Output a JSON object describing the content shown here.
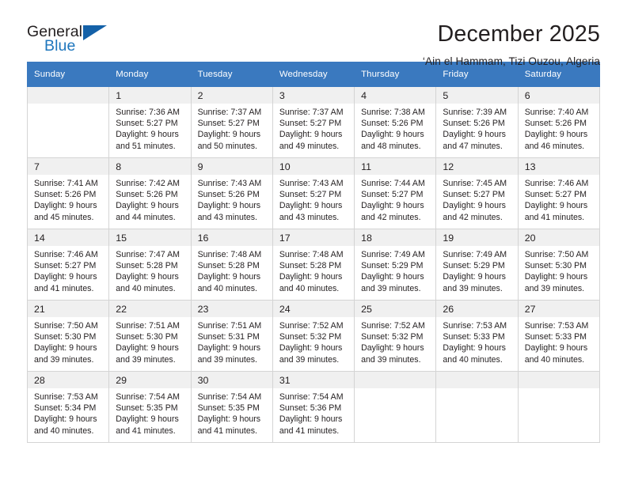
{
  "brand": {
    "name_part1": "General",
    "name_part2": "Blue",
    "triangle_color": "#1461a8",
    "blue_text_color": "#1e76bd"
  },
  "header": {
    "title": "December 2025",
    "subtitle": "‘Ain el Hammam, Tizi Ouzou, Algeria"
  },
  "theme": {
    "header_background": "#3a79bf",
    "header_text": "#ffffff",
    "daynum_background": "#f0f0f0",
    "cell_border": "#d4d4d4",
    "text": "#231f20"
  },
  "weekday_headers": [
    "Sunday",
    "Monday",
    "Tuesday",
    "Wednesday",
    "Thursday",
    "Friday",
    "Saturday"
  ],
  "labels": {
    "sunrise_prefix": "Sunrise:",
    "sunset_prefix": "Sunset:",
    "daylight_prefix": "Daylight:"
  },
  "weeks": [
    [
      {
        "day": "",
        "empty": true
      },
      {
        "day": "1",
        "sunrise": "Sunrise: 7:36 AM",
        "sunset": "Sunset: 5:27 PM",
        "daylight_line1": "Daylight: 9 hours",
        "daylight_line2": "and 51 minutes."
      },
      {
        "day": "2",
        "sunrise": "Sunrise: 7:37 AM",
        "sunset": "Sunset: 5:27 PM",
        "daylight_line1": "Daylight: 9 hours",
        "daylight_line2": "and 50 minutes."
      },
      {
        "day": "3",
        "sunrise": "Sunrise: 7:37 AM",
        "sunset": "Sunset: 5:27 PM",
        "daylight_line1": "Daylight: 9 hours",
        "daylight_line2": "and 49 minutes."
      },
      {
        "day": "4",
        "sunrise": "Sunrise: 7:38 AM",
        "sunset": "Sunset: 5:26 PM",
        "daylight_line1": "Daylight: 9 hours",
        "daylight_line2": "and 48 minutes."
      },
      {
        "day": "5",
        "sunrise": "Sunrise: 7:39 AM",
        "sunset": "Sunset: 5:26 PM",
        "daylight_line1": "Daylight: 9 hours",
        "daylight_line2": "and 47 minutes."
      },
      {
        "day": "6",
        "sunrise": "Sunrise: 7:40 AM",
        "sunset": "Sunset: 5:26 PM",
        "daylight_line1": "Daylight: 9 hours",
        "daylight_line2": "and 46 minutes."
      }
    ],
    [
      {
        "day": "7",
        "sunrise": "Sunrise: 7:41 AM",
        "sunset": "Sunset: 5:26 PM",
        "daylight_line1": "Daylight: 9 hours",
        "daylight_line2": "and 45 minutes."
      },
      {
        "day": "8",
        "sunrise": "Sunrise: 7:42 AM",
        "sunset": "Sunset: 5:26 PM",
        "daylight_line1": "Daylight: 9 hours",
        "daylight_line2": "and 44 minutes."
      },
      {
        "day": "9",
        "sunrise": "Sunrise: 7:43 AM",
        "sunset": "Sunset: 5:26 PM",
        "daylight_line1": "Daylight: 9 hours",
        "daylight_line2": "and 43 minutes."
      },
      {
        "day": "10",
        "sunrise": "Sunrise: 7:43 AM",
        "sunset": "Sunset: 5:27 PM",
        "daylight_line1": "Daylight: 9 hours",
        "daylight_line2": "and 43 minutes."
      },
      {
        "day": "11",
        "sunrise": "Sunrise: 7:44 AM",
        "sunset": "Sunset: 5:27 PM",
        "daylight_line1": "Daylight: 9 hours",
        "daylight_line2": "and 42 minutes."
      },
      {
        "day": "12",
        "sunrise": "Sunrise: 7:45 AM",
        "sunset": "Sunset: 5:27 PM",
        "daylight_line1": "Daylight: 9 hours",
        "daylight_line2": "and 42 minutes."
      },
      {
        "day": "13",
        "sunrise": "Sunrise: 7:46 AM",
        "sunset": "Sunset: 5:27 PM",
        "daylight_line1": "Daylight: 9 hours",
        "daylight_line2": "and 41 minutes."
      }
    ],
    [
      {
        "day": "14",
        "sunrise": "Sunrise: 7:46 AM",
        "sunset": "Sunset: 5:27 PM",
        "daylight_line1": "Daylight: 9 hours",
        "daylight_line2": "and 41 minutes."
      },
      {
        "day": "15",
        "sunrise": "Sunrise: 7:47 AM",
        "sunset": "Sunset: 5:28 PM",
        "daylight_line1": "Daylight: 9 hours",
        "daylight_line2": "and 40 minutes."
      },
      {
        "day": "16",
        "sunrise": "Sunrise: 7:48 AM",
        "sunset": "Sunset: 5:28 PM",
        "daylight_line1": "Daylight: 9 hours",
        "daylight_line2": "and 40 minutes."
      },
      {
        "day": "17",
        "sunrise": "Sunrise: 7:48 AM",
        "sunset": "Sunset: 5:28 PM",
        "daylight_line1": "Daylight: 9 hours",
        "daylight_line2": "and 40 minutes."
      },
      {
        "day": "18",
        "sunrise": "Sunrise: 7:49 AM",
        "sunset": "Sunset: 5:29 PM",
        "daylight_line1": "Daylight: 9 hours",
        "daylight_line2": "and 39 minutes."
      },
      {
        "day": "19",
        "sunrise": "Sunrise: 7:49 AM",
        "sunset": "Sunset: 5:29 PM",
        "daylight_line1": "Daylight: 9 hours",
        "daylight_line2": "and 39 minutes."
      },
      {
        "day": "20",
        "sunrise": "Sunrise: 7:50 AM",
        "sunset": "Sunset: 5:30 PM",
        "daylight_line1": "Daylight: 9 hours",
        "daylight_line2": "and 39 minutes."
      }
    ],
    [
      {
        "day": "21",
        "sunrise": "Sunrise: 7:50 AM",
        "sunset": "Sunset: 5:30 PM",
        "daylight_line1": "Daylight: 9 hours",
        "daylight_line2": "and 39 minutes."
      },
      {
        "day": "22",
        "sunrise": "Sunrise: 7:51 AM",
        "sunset": "Sunset: 5:30 PM",
        "daylight_line1": "Daylight: 9 hours",
        "daylight_line2": "and 39 minutes."
      },
      {
        "day": "23",
        "sunrise": "Sunrise: 7:51 AM",
        "sunset": "Sunset: 5:31 PM",
        "daylight_line1": "Daylight: 9 hours",
        "daylight_line2": "and 39 minutes."
      },
      {
        "day": "24",
        "sunrise": "Sunrise: 7:52 AM",
        "sunset": "Sunset: 5:32 PM",
        "daylight_line1": "Daylight: 9 hours",
        "daylight_line2": "and 39 minutes."
      },
      {
        "day": "25",
        "sunrise": "Sunrise: 7:52 AM",
        "sunset": "Sunset: 5:32 PM",
        "daylight_line1": "Daylight: 9 hours",
        "daylight_line2": "and 39 minutes."
      },
      {
        "day": "26",
        "sunrise": "Sunrise: 7:53 AM",
        "sunset": "Sunset: 5:33 PM",
        "daylight_line1": "Daylight: 9 hours",
        "daylight_line2": "and 40 minutes."
      },
      {
        "day": "27",
        "sunrise": "Sunrise: 7:53 AM",
        "sunset": "Sunset: 5:33 PM",
        "daylight_line1": "Daylight: 9 hours",
        "daylight_line2": "and 40 minutes."
      }
    ],
    [
      {
        "day": "28",
        "sunrise": "Sunrise: 7:53 AM",
        "sunset": "Sunset: 5:34 PM",
        "daylight_line1": "Daylight: 9 hours",
        "daylight_line2": "and 40 minutes."
      },
      {
        "day": "29",
        "sunrise": "Sunrise: 7:54 AM",
        "sunset": "Sunset: 5:35 PM",
        "daylight_line1": "Daylight: 9 hours",
        "daylight_line2": "and 41 minutes."
      },
      {
        "day": "30",
        "sunrise": "Sunrise: 7:54 AM",
        "sunset": "Sunset: 5:35 PM",
        "daylight_line1": "Daylight: 9 hours",
        "daylight_line2": "and 41 minutes."
      },
      {
        "day": "31",
        "sunrise": "Sunrise: 7:54 AM",
        "sunset": "Sunset: 5:36 PM",
        "daylight_line1": "Daylight: 9 hours",
        "daylight_line2": "and 41 minutes."
      },
      {
        "day": "",
        "empty": true
      },
      {
        "day": "",
        "empty": true
      },
      {
        "day": "",
        "empty": true
      }
    ]
  ]
}
